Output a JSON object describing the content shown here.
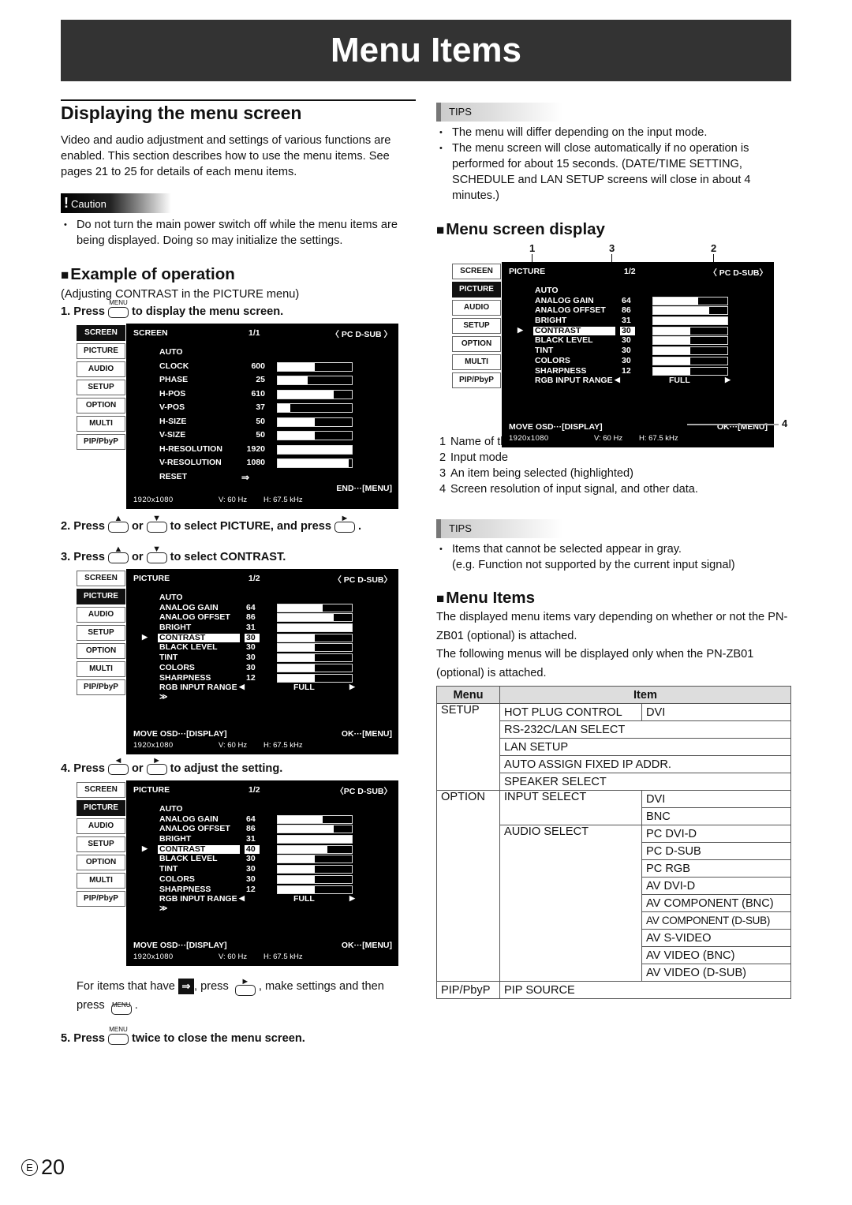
{
  "page_title": "Menu Items",
  "left": {
    "section_title": "Displaying the menu screen",
    "intro": "Video and audio adjustment and settings of various functions are enabled. This section describes how to use the menu items. See pages 21 to 25 for details of each menu items.",
    "caution_label": "Caution",
    "caution_items": [
      "Do not turn the main power switch off while the menu items are being displayed. Doing so may initialize the settings."
    ],
    "example_title": "Example of operation",
    "example_subtitle": "(Adjusting CONTRAST in the PICTURE menu)",
    "steps": {
      "s1": {
        "num": "1.",
        "pre": "Press",
        "key": "MENU",
        "post": "to display the menu screen."
      },
      "s2": {
        "num": "2.",
        "pre": "Press",
        "or": "or",
        "post": "to select PICTURE, and press",
        "end": "."
      },
      "s3": {
        "num": "3.",
        "pre": "Press",
        "or": "or",
        "post": "to select CONTRAST."
      },
      "s4": {
        "num": "4.",
        "pre": "Press",
        "or": "or",
        "post": "to adjust the setting."
      },
      "note_a": "For items that have",
      "note_b": ", press",
      "note_c": ", make settings and then",
      "note_d": "press",
      "note_e": ".",
      "s5": {
        "num": "5.",
        "pre": "Press",
        "key": "MENU",
        "post": "twice to close the menu screen."
      }
    }
  },
  "osd_tabs": [
    "SCREEN",
    "PICTURE",
    "AUDIO",
    "SETUP",
    "OPTION",
    "MULTI",
    "PIP/PbyP"
  ],
  "osd_screen": {
    "name": "SCREEN",
    "page": "1/1",
    "mode": "〈 PC D-SUB 〉",
    "items": [
      {
        "label": "AUTO"
      },
      {
        "label": "CLOCK",
        "value": "600",
        "level": 0.5
      },
      {
        "label": "PHASE",
        "value": "25",
        "level": 0.4
      },
      {
        "label": "H-POS",
        "value": "610",
        "level": 0.76
      },
      {
        "label": "V-POS",
        "value": "37",
        "level": 0.17
      },
      {
        "label": "H-SIZE",
        "value": "50",
        "level": 0.5
      },
      {
        "label": "V-SIZE",
        "value": "50",
        "level": 0.5
      },
      {
        "label": "H-RESOLUTION",
        "value": "1920",
        "level": 1.0
      },
      {
        "label": "V-RESOLUTION",
        "value": "1080",
        "level": 0.96
      },
      {
        "label": "RESET",
        "enter": "⇒"
      }
    ],
    "footer_right": "END···[MENU]",
    "resolution": "1920x1080",
    "vfreq": "V: 60 Hz",
    "hfreq": "H: 67.5 kHz"
  },
  "osd_picture_a": {
    "name": "PICTURE",
    "page": "1/2",
    "mode": "〈 PC D-SUB〉",
    "items": [
      {
        "label": "AUTO"
      },
      {
        "label": "ANALOG GAIN",
        "value": "64",
        "level": 0.61
      },
      {
        "label": "ANALOG OFFSET",
        "value": "86",
        "level": 0.76
      },
      {
        "label": "BRIGHT",
        "value": "31",
        "level": 1.0
      },
      {
        "label": "CONTRAST",
        "value": "30",
        "level": 0.5,
        "selected": true
      },
      {
        "label": "BLACK LEVEL",
        "value": "30",
        "level": 0.5
      },
      {
        "label": "TINT",
        "value": "30",
        "level": 0.5
      },
      {
        "label": "COLORS",
        "value": "30",
        "level": 0.5
      },
      {
        "label": "SHARPNESS",
        "value": "12",
        "level": 0.5
      },
      {
        "label": "RGB INPUT RANGE",
        "option": "FULL"
      }
    ],
    "more": "≫",
    "footer_left": "MOVE OSD···[DISPLAY]",
    "footer_right": "OK···[MENU]",
    "resolution": "1920x1080",
    "vfreq": "V: 60 Hz",
    "hfreq": "H: 67.5 kHz"
  },
  "osd_picture_b": {
    "name": "PICTURE",
    "page": "1/2",
    "mode": "〈PC D-SUB〉",
    "items": [
      {
        "label": "AUTO"
      },
      {
        "label": "ANALOG GAIN",
        "value": "64",
        "level": 0.61
      },
      {
        "label": "ANALOG OFFSET",
        "value": "86",
        "level": 0.76
      },
      {
        "label": "BRIGHT",
        "value": "31",
        "level": 1.0
      },
      {
        "label": "CONTRAST",
        "value": "40",
        "level": 0.67,
        "selected": true
      },
      {
        "label": "BLACK LEVEL",
        "value": "30",
        "level": 0.5
      },
      {
        "label": "TINT",
        "value": "30",
        "level": 0.5
      },
      {
        "label": "COLORS",
        "value": "30",
        "level": 0.5
      },
      {
        "label": "SHARPNESS",
        "value": "12",
        "level": 0.5
      },
      {
        "label": "RGB INPUT RANGE",
        "option": "FULL"
      }
    ],
    "more": "≫",
    "footer_left": "MOVE OSD···[DISPLAY]",
    "footer_right": "OK···[MENU]",
    "resolution": "1920x1080",
    "vfreq": "V: 60 Hz",
    "hfreq": "H: 67.5 kHz"
  },
  "osd_display": {
    "name": "PICTURE",
    "page": "1/2",
    "mode": "〈 PC D-SUB〉",
    "items": [
      {
        "label": "AUTO"
      },
      {
        "label": "ANALOG GAIN",
        "value": "64",
        "level": 0.61
      },
      {
        "label": "ANALOG OFFSET",
        "value": "86",
        "level": 0.76
      },
      {
        "label": "BRIGHT",
        "value": "31",
        "level": 1.0
      },
      {
        "label": "CONTRAST",
        "value": "30",
        "level": 0.5,
        "selected": true
      },
      {
        "label": "BLACK LEVEL",
        "value": "30",
        "level": 0.5
      },
      {
        "label": "TINT",
        "value": "30",
        "level": 0.5
      },
      {
        "label": "COLORS",
        "value": "30",
        "level": 0.5
      },
      {
        "label": "SHARPNESS",
        "value": "12",
        "level": 0.5
      },
      {
        "label": "RGB INPUT RANGE",
        "option": "FULL"
      }
    ],
    "footer_left": "MOVE OSD···[DISPLAY]",
    "footer_right": "OK···[MENU]",
    "resolution": "1920x1080",
    "vfreq": "V: 60 Hz",
    "hfreq": "H: 67.5 kHz",
    "callouts": [
      "1",
      "3",
      "2",
      "4"
    ]
  },
  "right": {
    "tips_label": "TIPS",
    "tips1": [
      "The menu will differ depending on the input mode.",
      "The menu screen will close automatically if no operation is performed for about 15 seconds. (DATE/TIME SETTING, SCHEDULE and LAN SETUP screens will close in about 4 minutes.)"
    ],
    "display_title": "Menu screen display",
    "legend": [
      {
        "n": "1",
        "text": "Name of the menu"
      },
      {
        "n": "2",
        "text": "Input mode"
      },
      {
        "n": "3",
        "text": "An item being selected (highlighted)"
      },
      {
        "n": "4",
        "text": "Screen resolution of input signal, and other data."
      }
    ],
    "tips2": [
      "Items that cannot be selected appear in gray.",
      "(e.g. Function not supported by the current input signal)"
    ],
    "items_title": "Menu Items",
    "items_p1": "The displayed menu items vary depending on whether or not the PN-ZB01 (optional) is attached.",
    "items_p2": "The following menus will be displayed only when the PN-ZB01 (optional) is attached.",
    "table": {
      "headers": [
        "Menu",
        "Item"
      ],
      "setup": {
        "menu": "SETUP",
        "r1a": "HOT PLUG CONTROL",
        "r1b": "DVI",
        "r2": "RS-232C/LAN SELECT",
        "r3": "LAN SETUP",
        "r4": "AUTO ASSIGN FIXED IP ADDR.",
        "r5": "SPEAKER SELECT"
      },
      "option": {
        "menu": "OPTION",
        "input": "INPUT SELECT",
        "input_opts": [
          "DVI",
          "BNC"
        ],
        "audio": "AUDIO SELECT",
        "audio_opts": [
          "PC DVI-D",
          "PC D-SUB",
          "PC RGB",
          "AV DVI-D",
          "AV COMPONENT (BNC)",
          "AV COMPONENT (D-SUB)",
          "AV S-VIDEO",
          "AV VIDEO (BNC)",
          "AV VIDEO (D-SUB)"
        ]
      },
      "pip": {
        "menu": "PIP/PbyP",
        "item": "PIP SOURCE"
      }
    }
  },
  "page_number": {
    "lang": "E",
    "num": "20"
  }
}
